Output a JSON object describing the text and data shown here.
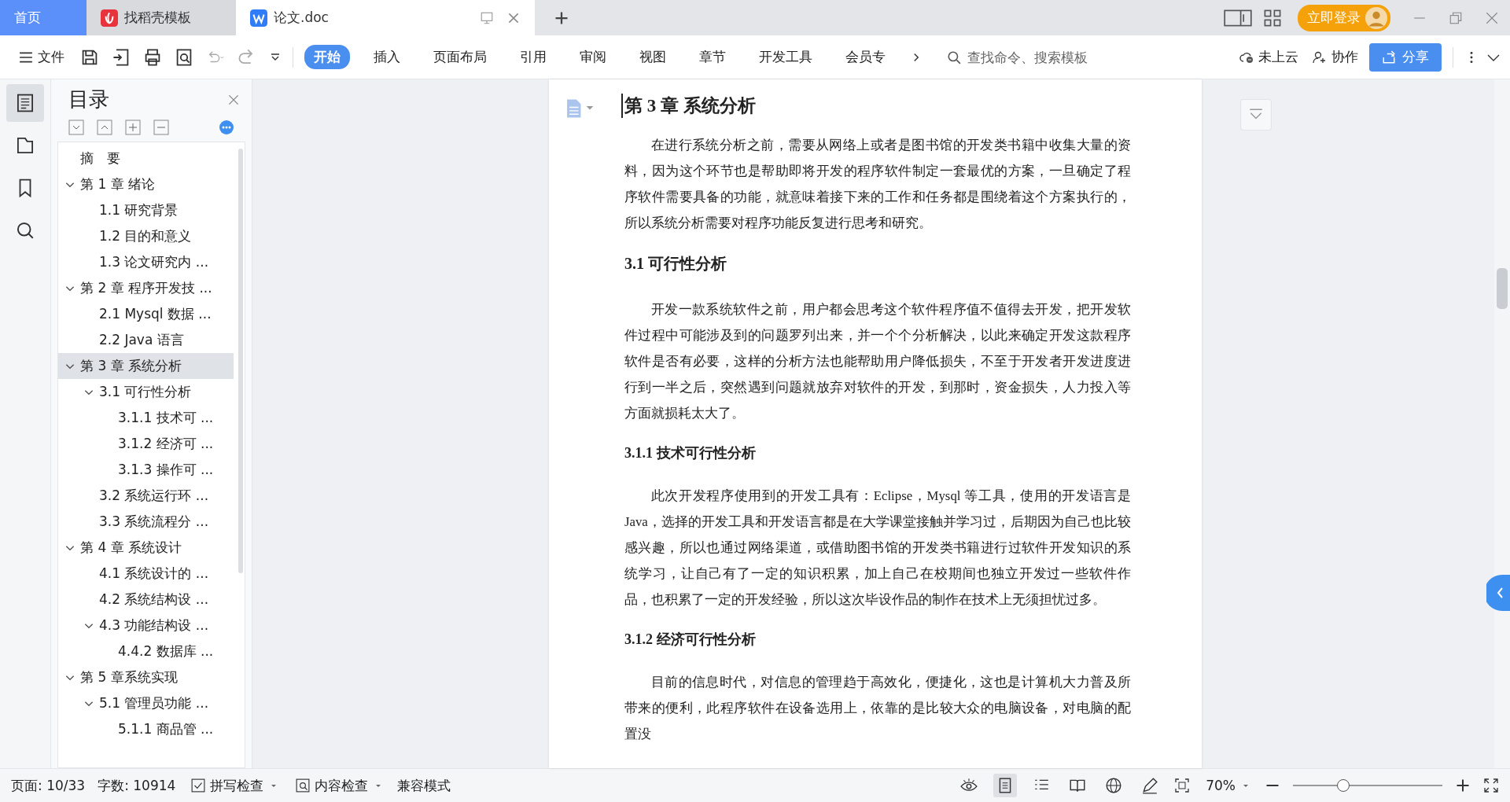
{
  "tabs": [
    {
      "label": "首页",
      "kind": "home",
      "selected": false
    },
    {
      "label": "找稻壳模板",
      "kind": "docer",
      "selected": false
    },
    {
      "label": "论文.doc",
      "kind": "doc",
      "selected": true
    }
  ],
  "title_bar": {
    "login": "立即登录"
  },
  "toolbar": {
    "file_menu": "文件",
    "ribbon_tabs": [
      {
        "label": "开始",
        "selected": true
      },
      {
        "label": "插入",
        "selected": false
      },
      {
        "label": "页面布局",
        "selected": false
      },
      {
        "label": "引用",
        "selected": false
      },
      {
        "label": "审阅",
        "selected": false
      },
      {
        "label": "视图",
        "selected": false
      },
      {
        "label": "章节",
        "selected": false
      },
      {
        "label": "开发工具",
        "selected": false
      },
      {
        "label": "会员专",
        "selected": false
      }
    ],
    "search": {
      "placeholder": "查找命令、搜索模板"
    },
    "cloud": "未上云",
    "collab": "协作",
    "share": "分享"
  },
  "rail": [
    {
      "kind": "toc",
      "selected": true
    },
    {
      "kind": "nav",
      "selected": false
    },
    {
      "kind": "bookmark",
      "selected": false
    },
    {
      "kind": "search",
      "selected": false
    }
  ],
  "toc": {
    "title": "目录",
    "items": [
      {
        "label": "摘　要",
        "selected": false
      },
      {
        "label": "第 1 章  绪论",
        "expanded": true,
        "selected": false,
        "children": [
          {
            "label": "1.1  研究背景",
            "selected": false
          },
          {
            "label": "1.2 目的和意义",
            "selected": false
          },
          {
            "label": "1.3  论文研究内 ...",
            "selected": false
          }
        ]
      },
      {
        "label": "第 2 章  程序开发技 ...",
        "expanded": true,
        "selected": false,
        "children": [
          {
            "label": "2.1 Mysql 数据 ...",
            "selected": false
          },
          {
            "label": "2.2 Java 语言",
            "selected": false
          }
        ]
      },
      {
        "label": "第 3 章  系统分析",
        "expanded": true,
        "selected": true,
        "children": [
          {
            "label": "3.1 可行性分析",
            "expanded": true,
            "selected": false,
            "children": [
              {
                "label": "3.1.1 技术可 ...",
                "selected": false
              },
              {
                "label": "3.1.2 经济可 ...",
                "selected": false
              },
              {
                "label": "3.1.3 操作可 ...",
                "selected": false
              }
            ]
          },
          {
            "label": "3.2 系统运行环 ...",
            "selected": false
          },
          {
            "label": "3.3 系统流程分 ...",
            "selected": false
          }
        ]
      },
      {
        "label": "第 4 章  系统设计",
        "expanded": true,
        "selected": false,
        "children": [
          {
            "label": "4.1  系统设计的 ...",
            "selected": false
          },
          {
            "label": "4.2  系统结构设 ...",
            "selected": false
          },
          {
            "label": "4.3 功能结构设 ...",
            "expanded": true,
            "selected": false,
            "children": [
              {
                "label": "4.4.2  数据库 ...",
                "selected": false
              }
            ]
          }
        ]
      },
      {
        "label": "第 5 章系统实现",
        "expanded": true,
        "selected": false,
        "children": [
          {
            "label": "5.1 管理员功能 ...",
            "expanded": true,
            "selected": false,
            "children": [
              {
                "label": "5.1.1  商品管 ...",
                "selected": false
              }
            ]
          }
        ]
      }
    ]
  },
  "document": {
    "blocks": [
      {
        "kind": "h1",
        "text": "第 3 章  系统分析"
      },
      {
        "kind": "p",
        "text": "在进行系统分析之前，需要从网络上或者是图书馆的开发类书籍中收集大量的资料，因为这个环节也是帮助即将开发的程序软件制定一套最优的方案，一旦确定了程序软件需要具备的功能，就意味着接下来的工作和任务都是围绕着这个方案执行的，所以系统分析需要对程序功能反复进行思考和研究。"
      },
      {
        "kind": "h2",
        "text": "3.1 可行性分析"
      },
      {
        "kind": "p",
        "text": "开发一款系统软件之前，用户都会思考这个软件程序值不值得去开发，把开发软件过程中可能涉及到的问题罗列出来，并一个个分析解决，以此来确定开发这款程序软件是否有必要，这样的分析方法也能帮助用户降低损失，不至于开发者开发进度进行到一半之后，突然遇到问题就放弃对软件的开发，到那时，资金损失，人力投入等方面就损耗太大了。"
      },
      {
        "kind": "h3",
        "text": "3.1.1 技术可行性分析"
      },
      {
        "kind": "p",
        "text": "此次开发程序使用到的开发工具有：Eclipse，Mysql 等工具，使用的开发语言是Java，选择的开发工具和开发语言都是在大学课堂接触并学习过，后期因为自己也比较感兴趣，所以也通过网络渠道，或借助图书馆的开发类书籍进行过软件开发知识的系统学习，让自己有了一定的知识积累，加上自己在校期间也独立开发过一些软件作品，也积累了一定的开发经验，所以这次毕设作品的制作在技术上无须担忧过多。"
      },
      {
        "kind": "h3",
        "text": "3.1.2 经济可行性分析"
      },
      {
        "kind": "p",
        "text": "目前的信息时代，对信息的管理趋于高效化，便捷化，这也是计算机大力普及所带来的便利，此程序软件在设备选用上，依靠的是比较大众的电脑设备，对电脑的配置没"
      }
    ]
  },
  "status_bar": {
    "page": "页面: 10/33",
    "words": "字数: 10914",
    "spell": "拼写检查",
    "content": "内容检查",
    "compat": "兼容模式",
    "zoom": "70%",
    "zoom_slider": {
      "level": 0.32
    },
    "views": [
      {
        "kind": "eye",
        "selected": false
      },
      {
        "kind": "page",
        "selected": true
      },
      {
        "kind": "outline",
        "selected": false
      },
      {
        "kind": "read",
        "selected": false
      },
      {
        "kind": "web",
        "selected": false
      },
      {
        "kind": "pen",
        "selected": false
      }
    ]
  }
}
